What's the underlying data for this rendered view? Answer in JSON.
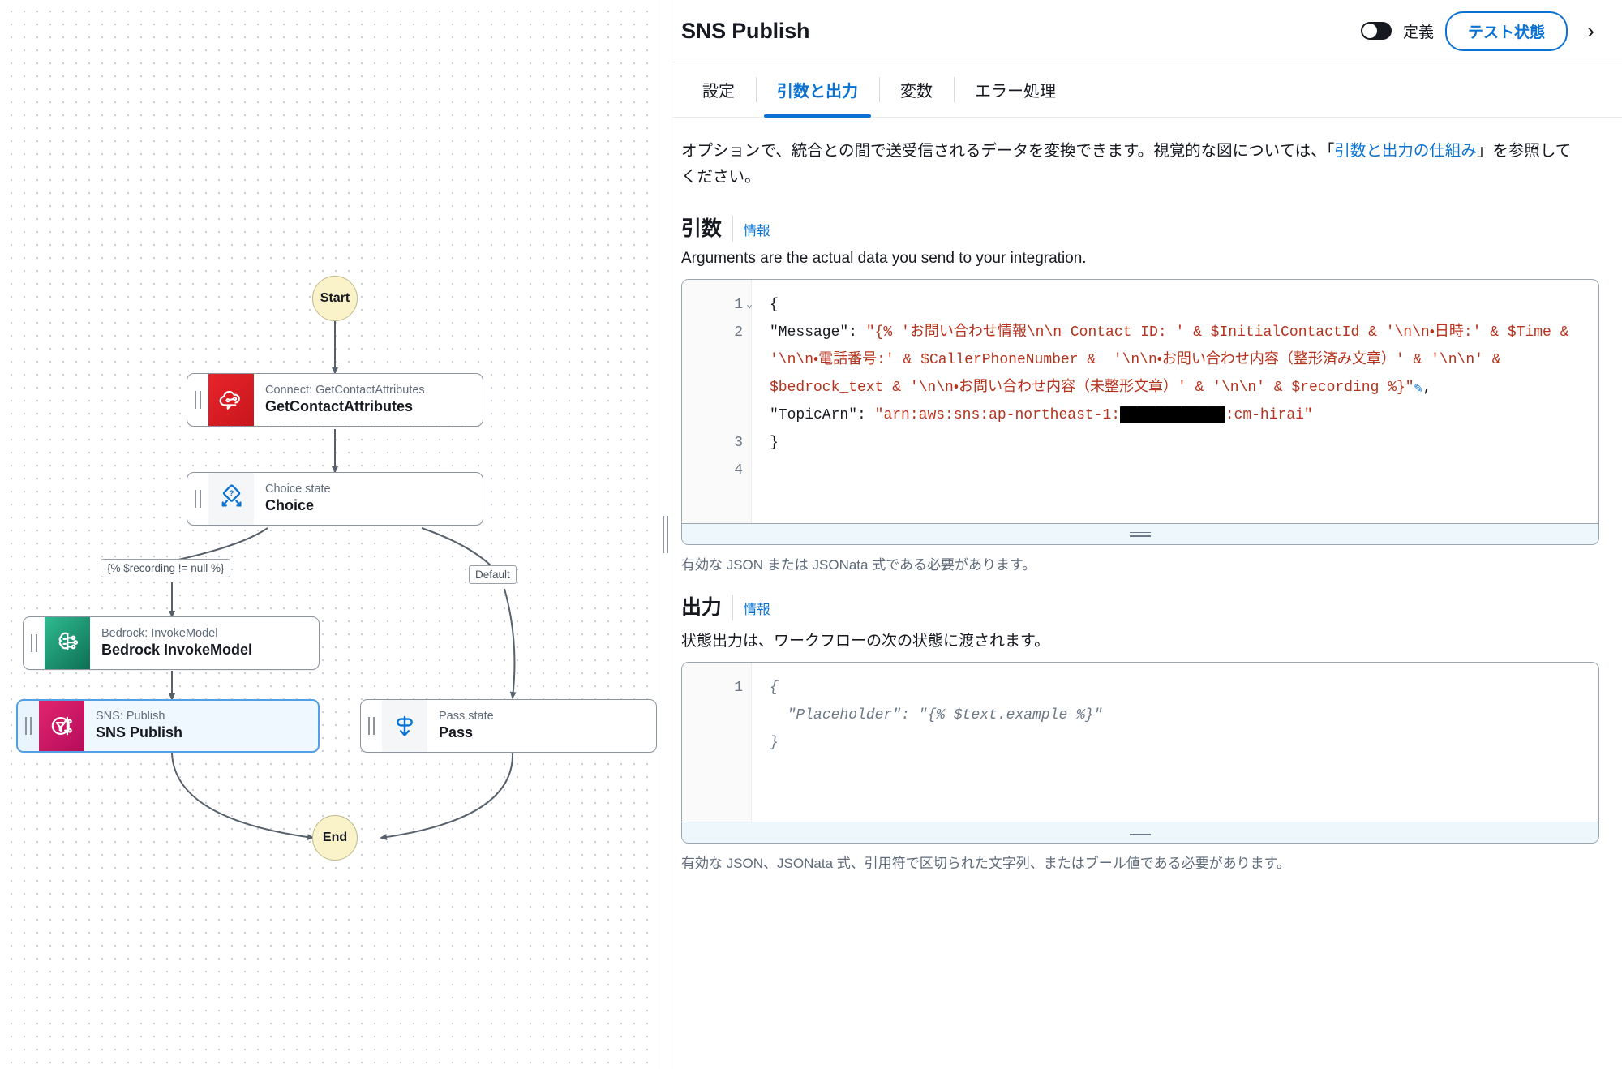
{
  "header": {
    "title": "SNS Publish",
    "toggle_label": "定義",
    "toggle_state": "off",
    "test_state_button": "テスト状態",
    "collapse_icon": "chevron-right-icon",
    "accent_color": "#0972d3"
  },
  "tabs": [
    {
      "label": "設定",
      "active": false
    },
    {
      "label": "引数と出力",
      "active": true
    },
    {
      "label": "変数",
      "active": false
    },
    {
      "label": "エラー処理",
      "active": false
    }
  ],
  "intro": {
    "text_before": "オプションで、統合との間で送受信されるデータを変換できます。視覚的な図については、「",
    "link_text": "引数と出力の仕組み",
    "text_after": "」を参照してください。"
  },
  "arguments_section": {
    "heading": "引数",
    "info_label": "情報",
    "helper": "Arguments are the actual data you send to your integration.",
    "constraint": "有効な JSON または JSONata 式である必要があります。",
    "line_numbers": [
      "1",
      "2",
      "3",
      "4"
    ],
    "fold_marker": "⌄",
    "code_lines": [
      "{",
      "  \"Message\": \"{% 'お問い合わせ情報\\n\\n Contact ID: ' & $InitialContactId & '\\n\\n・日時:' & $Time & '\\n\\n・電話番号:' & $CallerPhoneNumber &  '\\n\\n・お問い合わせ内容（整形済み文章）' & '\\n\\n' & $bedrock_text & '\\n\\n・お問い合わせ内容（未整形文章）' & '\\n\\n' & $recording %}\" ✎ ,",
      "  \"TopicArn\": \"arn:aws:sns:ap-northeast-1:█████████:cm-hirai\"",
      "}"
    ],
    "code_tokens": {
      "line1_open_brace": "{",
      "message_key": "\"Message\"",
      "message_value": "\"{% 'お問い合わせ情報\\n\\n Contact ID: ' & $InitialContactId & '\\n\\n・日時:' & $Time & '\\n\\n・電話番号:' & $CallerPhoneNumber &  '\\n\\n・お問い合わせ内容（整形済み文章）' & '\\n\\n' & $bedrock_text & '\\n\\n・お問い合わせ内容（未整形文章）' & '\\n\\n' & $recording %}\"",
      "edit_icon": "pencil-icon",
      "comma": ",",
      "topicarn_key": "\"TopicArn\"",
      "topicarn_value_prefix": "\"arn:aws:sns:ap-northeast-1:",
      "topicarn_redacted": "████████████",
      "topicarn_value_suffix": ":cm-hirai\"",
      "line4_close_brace": "}"
    }
  },
  "output_section": {
    "heading": "出力",
    "info_label": "情報",
    "helper": "状態出力は、ワークフローの次の状態に渡されます。",
    "constraint": "有効な JSON、JSONata 式、引用符で区切られた文字列、またはブール値である必要があります。",
    "line_numbers": [
      "1"
    ],
    "placeholder_code": "{\n  \"Placeholder\": \"{% $text.example %}\"\n}"
  },
  "workflow": {
    "start_node": {
      "label": "Start"
    },
    "end_node": {
      "label": "End"
    },
    "nodes": [
      {
        "id": "getcontactattributes",
        "sub": "Connect: GetContactAttributes",
        "main": "GetContactAttributes",
        "icon": "amazon-connect-icon",
        "color": "#d7141a",
        "selected": false
      },
      {
        "id": "choice",
        "sub": "Choice state",
        "main": "Choice",
        "icon": "choice-diamond-icon",
        "color": "#0972d3",
        "selected": false
      },
      {
        "id": "bedrock-invokemodel",
        "sub": "Bedrock: InvokeModel",
        "main": "Bedrock InvokeModel",
        "icon": "bedrock-brain-icon",
        "color": "#1a7f64",
        "selected": false
      },
      {
        "id": "sns-publish",
        "sub": "SNS: Publish",
        "main": "SNS Publish",
        "icon": "amazon-sns-icon",
        "color": "#c9186a",
        "selected": true
      },
      {
        "id": "pass",
        "sub": "Pass state",
        "main": "Pass",
        "icon": "pass-arrow-icon",
        "color": "#0972d3",
        "selected": false
      }
    ],
    "edge_labels": [
      {
        "id": "choice-rule",
        "text": "{% $recording != null %}"
      },
      {
        "id": "choice-default",
        "text": "Default"
      }
    ]
  }
}
